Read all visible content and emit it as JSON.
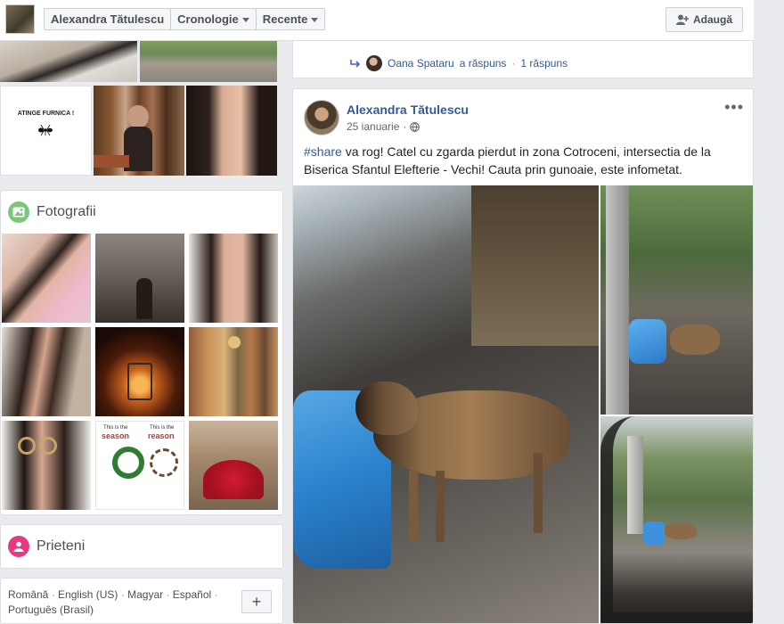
{
  "topbar": {
    "name": "Alexandra Tătulescu",
    "timeline": "Cronologie",
    "recent": "Recente",
    "add_label": "Adaugă"
  },
  "photo_strip": {
    "tile_text": "ATINGE FURNICA !"
  },
  "photos_card": {
    "title": "Fotografii",
    "icon_color": "#7bc67b",
    "grid_texts": {
      "left": "This is the",
      "left_strong": "season",
      "right": "This is the",
      "right_strong": "reason"
    }
  },
  "friends_card": {
    "title": "Prieteni",
    "icon_color": "#e6397f"
  },
  "footer": {
    "languages": [
      "Română",
      "English (US)",
      "Magyar",
      "Español",
      "Português (Brasil)"
    ],
    "separator": "·",
    "plus": "+"
  },
  "reply_card": {
    "top_text": "·",
    "replier": "Oana Spataru",
    "replied": "a răspuns",
    "sep": "·",
    "count": "1 răspuns"
  },
  "post": {
    "author": "Alexandra Tătulescu",
    "date": "25 ianuarie",
    "dot": "·",
    "more": "•••",
    "hashtag": "#share",
    "text": " va rog! Catel cu zgarda pierdut in zona Cotroceni, intersectia de la Biserica Sfantul Elefterie - Vechi! Cauta prin gunoaie, este infometat."
  },
  "colors": {
    "link": "#365899",
    "bg": "#e9ebee",
    "accent_blue": "#2a8ef0"
  }
}
